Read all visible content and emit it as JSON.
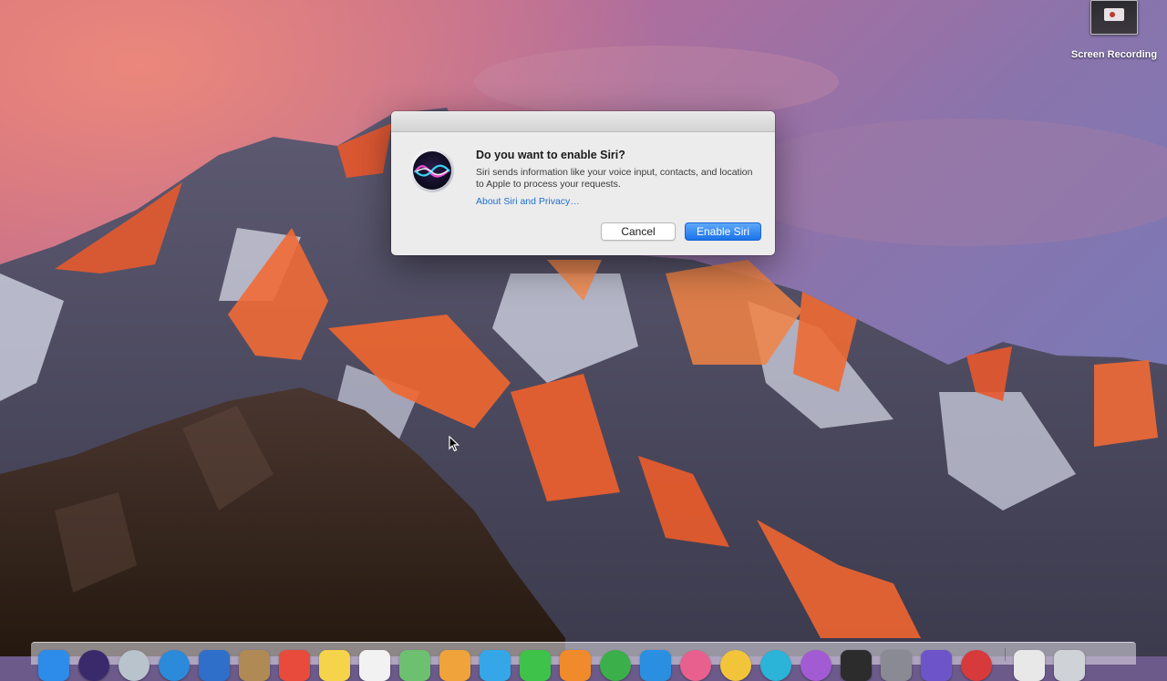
{
  "desktop": {
    "wallpaper": "macOS Sierra mountain",
    "file_icon": {
      "label": "Screen Recording",
      "icon": "video-file-thumbnail-icon"
    }
  },
  "dialog": {
    "title": "Do you want to enable Siri?",
    "message": "Siri sends information like your voice input, contacts, and location to Apple to process your requests.",
    "link": "About Siri and Privacy…",
    "cancel_label": "Cancel",
    "enable_label": "Enable Siri",
    "icon": "siri-icon",
    "accent_color": "#1b73e8",
    "link_color": "#1f6fd1"
  },
  "dock": {
    "apps": [
      {
        "name": "finder",
        "color": "#2d8bea"
      },
      {
        "name": "siri",
        "color": "#3b2a6b"
      },
      {
        "name": "launchpad",
        "color": "#b9c3cc"
      },
      {
        "name": "safari",
        "color": "#2b8ad9"
      },
      {
        "name": "mail",
        "color": "#2f6fc9"
      },
      {
        "name": "contacts",
        "color": "#b08a55"
      },
      {
        "name": "calendar",
        "color": "#e84b3c"
      },
      {
        "name": "notes",
        "color": "#f5d34b"
      },
      {
        "name": "reminders",
        "color": "#f2f2f2"
      },
      {
        "name": "maps",
        "color": "#6cc070"
      },
      {
        "name": "photos",
        "color": "#f0a33a"
      },
      {
        "name": "messages",
        "color": "#35a7e8"
      },
      {
        "name": "facetime",
        "color": "#3ec24a"
      },
      {
        "name": "ibooks",
        "color": "#f08a2b"
      },
      {
        "name": "itunes",
        "color": "#3bb04a"
      },
      {
        "name": "app-store",
        "color": "#2a8fe0"
      },
      {
        "name": "photo-booth",
        "color": "#e8608e"
      },
      {
        "name": "games",
        "color": "#f2c43a"
      },
      {
        "name": "app-blue",
        "color": "#2bb3d8"
      },
      {
        "name": "podcasts",
        "color": "#a35bd3"
      },
      {
        "name": "terminal",
        "color": "#2c2c2c"
      },
      {
        "name": "preferences",
        "color": "#8a8a95"
      },
      {
        "name": "feedback",
        "color": "#6d55c9"
      },
      {
        "name": "app-red",
        "color": "#d63a3a"
      },
      {
        "name": "documents",
        "color": "#e8e8e8"
      },
      {
        "name": "trash",
        "color": "#cfd2d6"
      }
    ]
  }
}
